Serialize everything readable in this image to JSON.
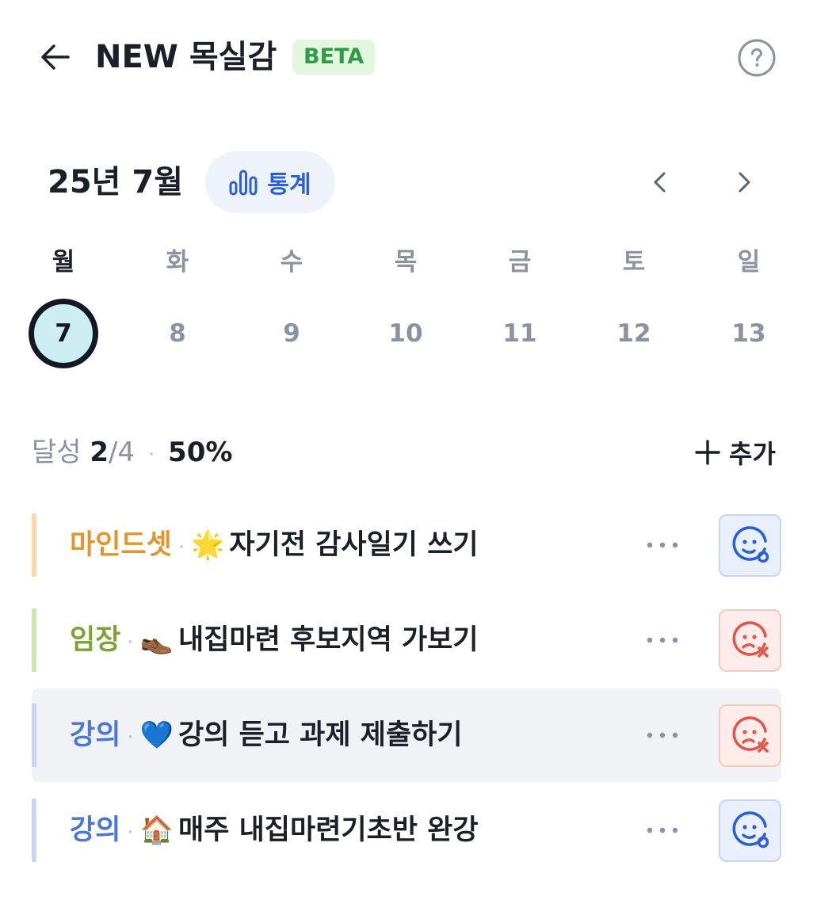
{
  "header": {
    "title": "NEW 목실감",
    "badge": "BETA"
  },
  "month": {
    "label": "25년 7월",
    "stats_label": "통계"
  },
  "week": {
    "days": [
      {
        "name": "월",
        "num": "7",
        "selected": true
      },
      {
        "name": "화",
        "num": "8"
      },
      {
        "name": "수",
        "num": "9"
      },
      {
        "name": "목",
        "num": "10"
      },
      {
        "name": "금",
        "num": "11"
      },
      {
        "name": "토",
        "num": "12"
      },
      {
        "name": "일",
        "num": "13"
      }
    ]
  },
  "achievement": {
    "label": "달성",
    "done": "2",
    "total": "/4",
    "separator": "·",
    "percent": "50%",
    "add_label": "추가"
  },
  "tasks": [
    {
      "category": "마인드셋",
      "emoji": "🌟",
      "name": "자기전 감사일기 쓰기",
      "color": "#e0962c",
      "bar": "#fbd9ae",
      "status": "done"
    },
    {
      "category": "임장",
      "emoji": "👞",
      "name": "내집마련 후보지역 가보기",
      "color": "#7aa535",
      "bar": "#cde8b3",
      "status": "fail"
    },
    {
      "category": "강의",
      "emoji": "💙",
      "name": "강의 듣고 과제 제출하기",
      "color": "#4a78d4",
      "bar": "#c9d7f3",
      "status": "fail"
    },
    {
      "category": "강의",
      "emoji": "🏠",
      "name": "매주 내집마련기초반 완강",
      "color": "#4a78d4",
      "bar": "#c9d7f3",
      "status": "done"
    }
  ],
  "colors": {
    "accent_blue": "#2a5fd6",
    "fail_red": "#e0574b",
    "beta_bg": "#e5f6df",
    "beta_text": "#2f9a4a"
  }
}
